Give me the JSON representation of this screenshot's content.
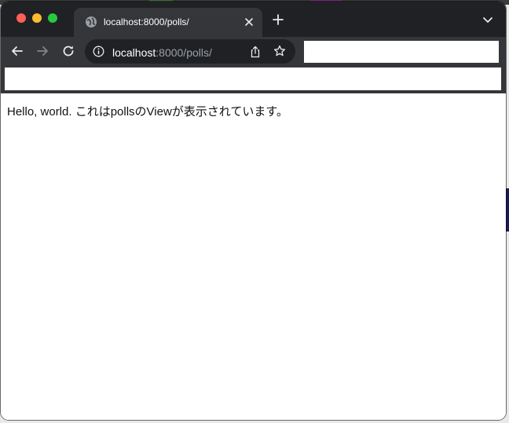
{
  "browser": {
    "tab": {
      "title": "localhost:8000/polls/",
      "favicon": "globe-icon"
    },
    "address": {
      "host": "localhost",
      "rest": ":8000/polls/"
    }
  },
  "colors": {
    "tabstrip": "#202124",
    "toolbar": "#35363a",
    "traffic_red": "#ff5f57",
    "traffic_yellow": "#febc2e",
    "traffic_green": "#28c840"
  },
  "page": {
    "text": "Hello, world. これはpollsのViewが表示されています。"
  }
}
